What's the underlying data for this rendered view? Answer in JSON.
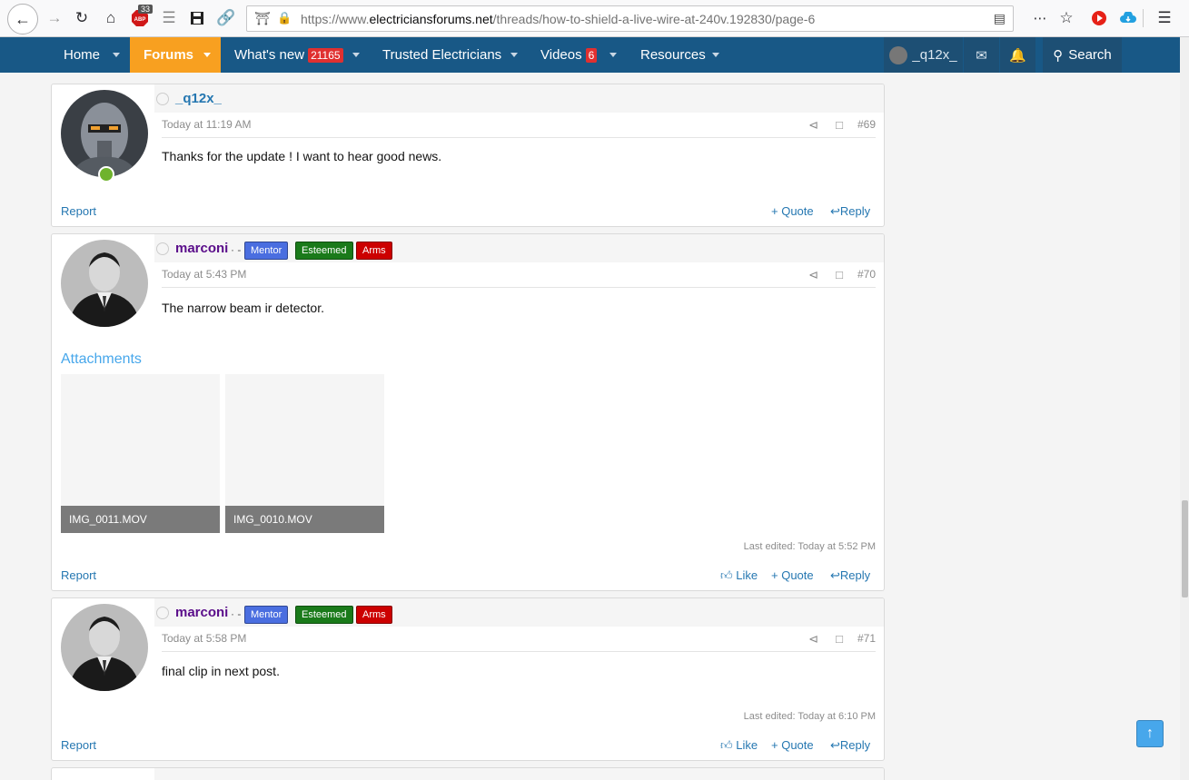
{
  "browser": {
    "url_prefix": "https://www.",
    "url_domain": "electriciansforums.net",
    "url_path": "/threads/how-to-shield-a-live-wire-at-240v.192830/page-6",
    "abp_count": "33"
  },
  "nav": {
    "home": "Home",
    "forums": "Forums",
    "whats_new": "What's new",
    "whats_new_count": "21165",
    "trusted": "Trusted Electricians",
    "videos": "Videos",
    "videos_count": "6",
    "resources": "Resources",
    "account_name": "_q12x_",
    "search": "Search"
  },
  "posts": [
    {
      "username": "_q12x_",
      "time": "Today at 11:19 AM",
      "number": "#69",
      "body": "Thanks for the update ! I want to hear good news.",
      "report": "Report",
      "quote": "+ Quote",
      "reply": "Reply"
    },
    {
      "username": "marconi",
      "dots": "· -",
      "badges": [
        "Mentor",
        "Esteemed",
        "Arms"
      ],
      "time": "Today at 5:43 PM",
      "number": "#70",
      "body": "The narrow beam ir detector.",
      "attachments_title": "Attachments",
      "attachments": [
        "IMG_0011.MOV",
        "IMG_0010.MOV"
      ],
      "last_edited": "Last edited: Today at 5:52 PM",
      "report": "Report",
      "like": "Like",
      "quote": "+ Quote",
      "reply": "Reply"
    },
    {
      "username": "marconi",
      "dots": "· -",
      "badges": [
        "Mentor",
        "Esteemed",
        "Arms"
      ],
      "time": "Today at 5:58 PM",
      "number": "#71",
      "body": "final clip in next post.",
      "last_edited": "Last edited: Today at 6:10 PM",
      "report": "Report",
      "like": "Like",
      "quote": "+ Quote",
      "reply": "Reply"
    }
  ],
  "colors": {
    "nav_bg": "#185886",
    "forums_tab": "#f8a020",
    "link": "#2577b1",
    "username_q12x": "#2577b1",
    "username_marconi": "#5a0d8a",
    "mentor_badge": "#4a6ee0",
    "esteemed_badge": "#1a7a1a",
    "arms_badge": "#cc0000"
  }
}
